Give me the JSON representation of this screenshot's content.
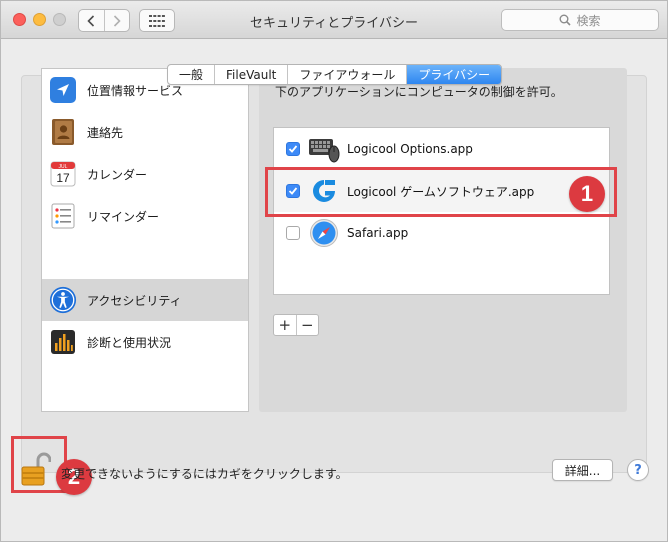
{
  "window": {
    "title": "セキュリティとプライバシー",
    "search_placeholder": "検索"
  },
  "tabs": [
    {
      "label": "一般",
      "active": false
    },
    {
      "label": "FileVault",
      "active": false
    },
    {
      "label": "ファイアウォール",
      "active": false
    },
    {
      "label": "プライバシー",
      "active": true
    }
  ],
  "sidebar": {
    "items": [
      {
        "label": "位置情報サービス",
        "icon": "location-arrow-icon"
      },
      {
        "label": "連絡先",
        "icon": "contacts-book-icon"
      },
      {
        "label": "カレンダー",
        "icon": "calendar-icon",
        "icon_month": "JUL",
        "icon_day": "17"
      },
      {
        "label": "リマインダー",
        "icon": "reminders-icon"
      },
      {
        "label": "アクセシビリティ",
        "icon": "accessibility-icon",
        "selected": true
      },
      {
        "label": "診断と使用状況",
        "icon": "diagnostics-icon"
      }
    ]
  },
  "privacy": {
    "description": "下のアプリケーションにコンピュータの制御を許可。",
    "apps": [
      {
        "name": "Logicool Options.app",
        "checked": true,
        "icon": "keyboard-mouse-icon"
      },
      {
        "name": "Logicool ゲームソフトウェア.app",
        "checked": true,
        "icon": "logitech-g-icon"
      },
      {
        "name": "Safari.app",
        "checked": false,
        "icon": "safari-compass-icon"
      }
    ],
    "add_label": "+",
    "remove_label": "−"
  },
  "footer": {
    "lock_text": "変更できないようにするにはカギをクリックします。",
    "details_label": "詳細...",
    "help_label": "?"
  },
  "annotations": {
    "badge1": "1",
    "badge2": "2",
    "highlight_color": "#e04449"
  },
  "colors": {
    "accent": "#2e86f0",
    "checkbox": "#3d8af7"
  }
}
